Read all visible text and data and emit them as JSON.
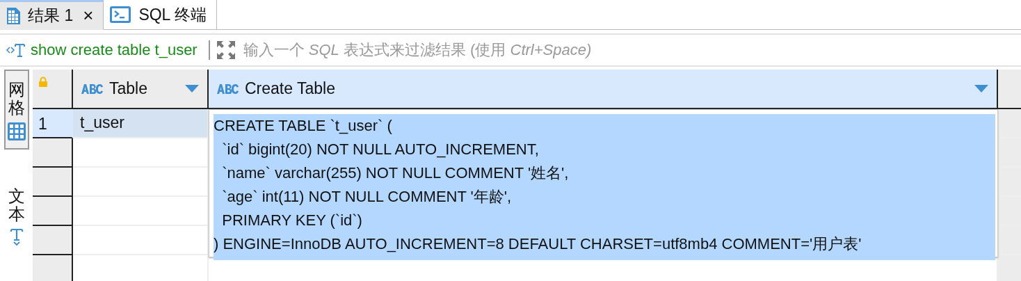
{
  "tabs": [
    {
      "label": "结果 1",
      "kind": "results",
      "selected": true,
      "close": "×"
    },
    {
      "label": "SQL 终端",
      "kind": "terminal",
      "selected": false
    }
  ],
  "filter": {
    "query": "show create table t_user",
    "placeholder": "输入一个 *SQL* 表达式来过滤结果 (使用 *Ctrl+Space)*"
  },
  "view_switcher": [
    {
      "label": "网格",
      "kind": "grid",
      "selected": true
    },
    {
      "label": "文本",
      "kind": "text",
      "selected": false
    }
  ],
  "table": {
    "columns": [
      {
        "label": "Table",
        "selected": false
      },
      {
        "label": "Create Table",
        "selected": true
      }
    ],
    "rows": [
      {
        "number": "1",
        "table": "t_user",
        "selected": true,
        "create_table": {
          "text_selected": true,
          "lines": [
            "CREATE TABLE `t_user` (",
            "  `id` bigint(20) NOT NULL AUTO_INCREMENT,",
            "  `name` varchar(255) NOT NULL COMMENT '姓名',",
            "  `age` int(11) NOT NULL COMMENT '年龄',",
            "  PRIMARY KEY (`id`)",
            ") ENGINE=InnoDB AUTO_INCREMENT=8 DEFAULT CHARSET=utf8mb4 COMMENT='用户表'"
          ]
        }
      }
    ]
  }
}
